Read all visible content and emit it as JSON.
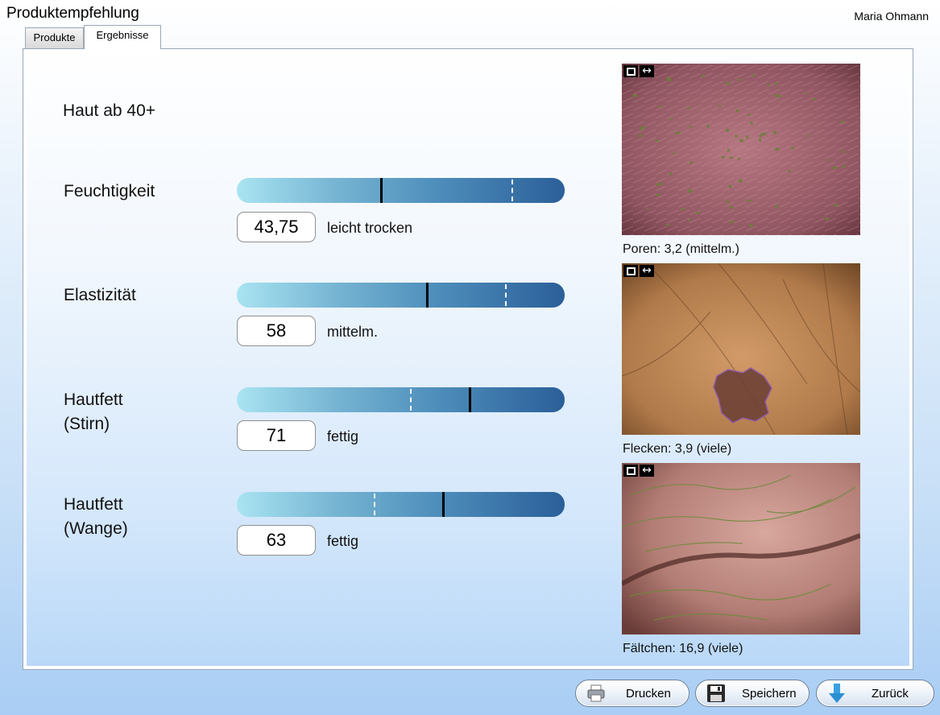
{
  "app": {
    "title": "Produktempfehlung",
    "user": "Maria Ohmann"
  },
  "tabs": [
    {
      "label": "Produkte",
      "active": false
    },
    {
      "label": "Ergebnisse",
      "active": true
    }
  ],
  "skin_type": "Haut ab 40+",
  "metrics": [
    {
      "label": "Feuchtigkeit",
      "value": "43,75",
      "rating": "leicht trocken",
      "marker_fraction": 0.44,
      "reference_fraction": 0.84
    },
    {
      "label": "Elastizität",
      "value": "58",
      "rating": "mittelm.",
      "marker_fraction": 0.58,
      "reference_fraction": 0.82
    },
    {
      "label": "Hautfett\n(Stirn)",
      "value": "71",
      "rating": "fettig",
      "marker_fraction": 0.71,
      "reference_fraction": 0.53
    },
    {
      "label": "Hautfett\n(Wange)",
      "value": "63",
      "rating": "fettig",
      "marker_fraction": 0.63,
      "reference_fraction": 0.42
    }
  ],
  "images": [
    {
      "caption": "Poren: 3,2 (mittelm.)",
      "kind": "pores"
    },
    {
      "caption": "Flecken: 3,9 (viele)",
      "kind": "spots"
    },
    {
      "caption": "Fältchen: 16,9 (viele)",
      "kind": "wrinkles"
    }
  ],
  "buttons": {
    "print": "Drucken",
    "save": "Speichern",
    "back": "Zurück"
  },
  "icons": {
    "print": "printer-icon",
    "save": "floppy-disk-icon",
    "back": "down-arrow-icon",
    "image_frame": "frame-icon",
    "image_resize": "resize-arrows-icon"
  },
  "colors": {
    "bar_start": "#a9e4f2",
    "bar_end": "#2b5f99",
    "marker": "#000000",
    "reference": "#ffffff"
  }
}
